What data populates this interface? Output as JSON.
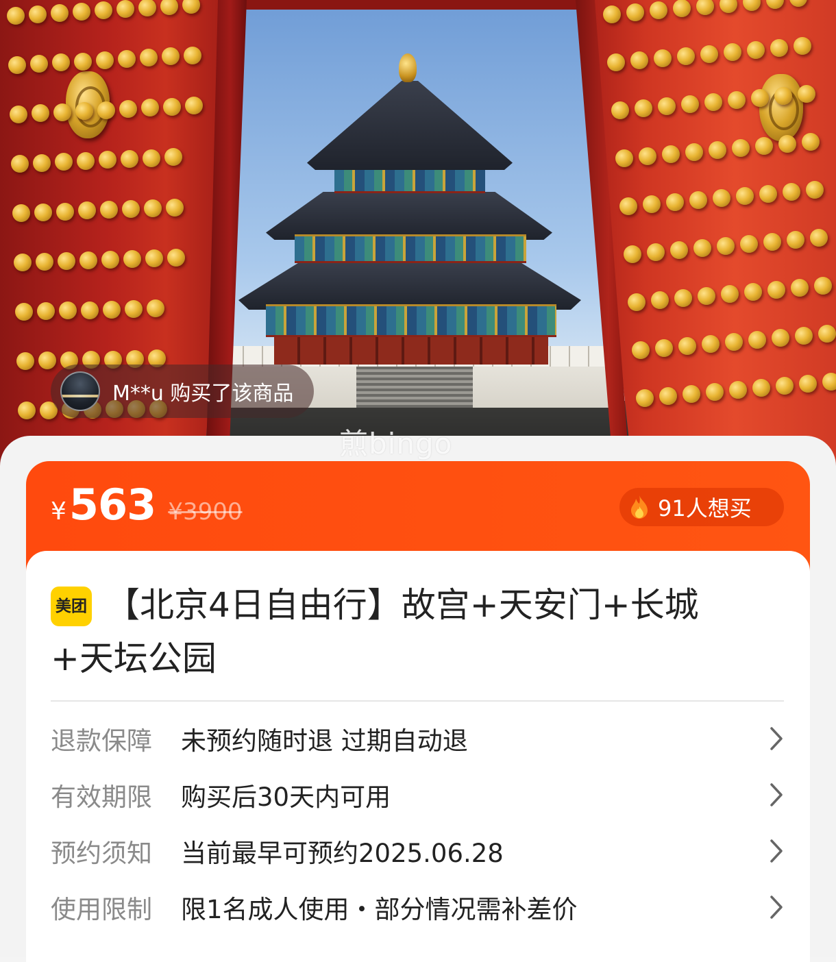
{
  "hero": {
    "buyer_notice": "M**u 购买了该商品",
    "watermark": "煎bingo"
  },
  "price_bar": {
    "currency": "¥",
    "price": "563",
    "original_price": "¥3900",
    "want_count": "91人想买",
    "accent_color": "#ff4a0e"
  },
  "product": {
    "brand_badge": "美团",
    "brand_color": "#ffd100",
    "title_line1": "【北京4日自由行】故宫+天安门+长城",
    "title_line2": "+天坛公园"
  },
  "info_rows": [
    {
      "label": "退款保障",
      "value": "未预约随时退 过期自动退"
    },
    {
      "label": "有效期限",
      "value": "购买后30天内可用"
    },
    {
      "label": "预约须知",
      "value": "当前最早可预约2025.06.28"
    },
    {
      "label": "使用限制",
      "value": "限1名成人使用・部分情况需补差价"
    }
  ],
  "icons": {
    "flame": "flame-icon",
    "chevron": "chevron-right-icon",
    "avatar": "avatar"
  }
}
